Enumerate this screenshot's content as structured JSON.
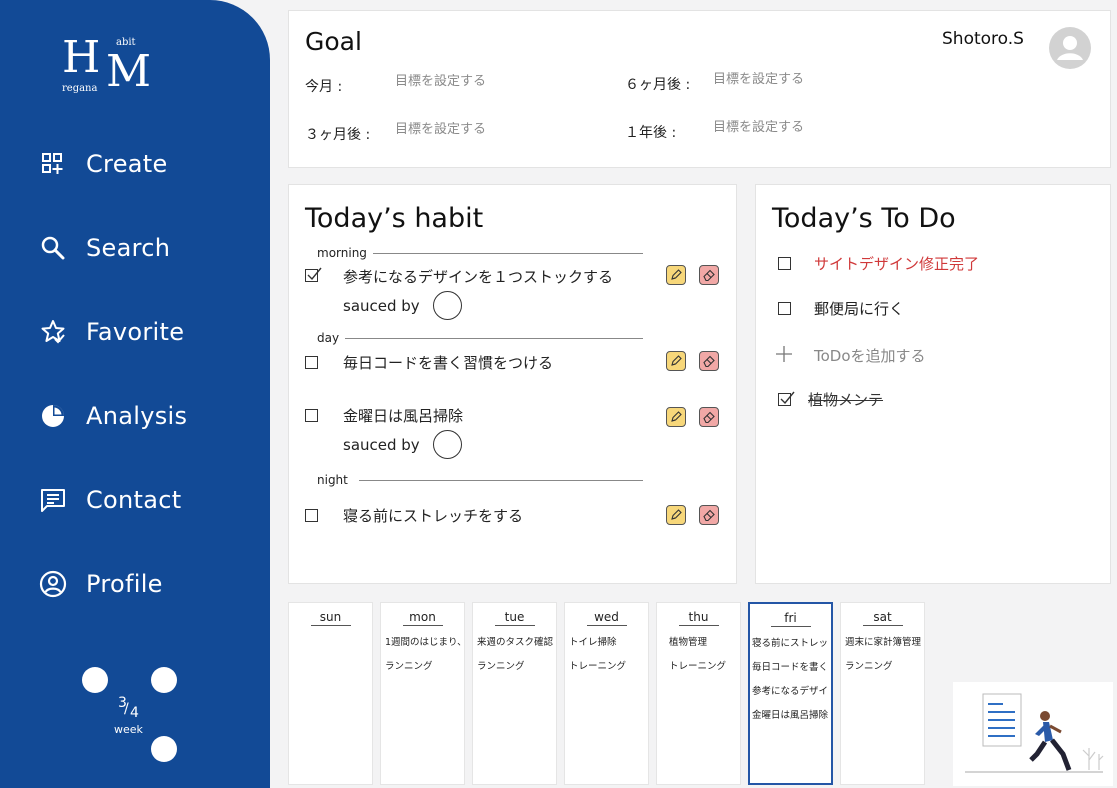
{
  "app": {
    "logo": {
      "big_h": "H",
      "big_m": "M",
      "small_abit": "abit",
      "small_regana": "regana"
    }
  },
  "sidebar": {
    "items": [
      {
        "label": "Create",
        "icon": "create-icon"
      },
      {
        "label": "Search",
        "icon": "search-icon"
      },
      {
        "label": "Favorite",
        "icon": "favorite-icon"
      },
      {
        "label": "Analysis",
        "icon": "analysis-icon"
      },
      {
        "label": "Contact",
        "icon": "contact-icon"
      },
      {
        "label": "Profile",
        "icon": "profile-icon"
      }
    ],
    "week": {
      "numerator": "3",
      "slash": "/",
      "denominator": "4",
      "label": "week"
    }
  },
  "goal": {
    "title": "Goal",
    "user": "Shotoro.S",
    "rows": [
      {
        "key": "今月 :",
        "placeholder": "目標を設定する"
      },
      {
        "key": "６ヶ月後 :",
        "placeholder": "目標を設定する"
      },
      {
        "key": "３ヶ月後 :",
        "placeholder": "目標を設定する"
      },
      {
        "key": "１年後 :",
        "placeholder": "目標を設定する"
      }
    ]
  },
  "habit": {
    "title": "Today’s habit",
    "sections": {
      "morning": "morning",
      "day": "day",
      "night": "night"
    },
    "items": [
      {
        "text": "参考になるデザインを１つストックする",
        "checked": true,
        "sauced": "sauced by"
      },
      {
        "text": "毎日コードを書く習慣をつける",
        "checked": false
      },
      {
        "text": "金曜日は風呂掃除",
        "checked": false,
        "sauced": "sauced by"
      },
      {
        "text": "寝る前にストレッチをする",
        "checked": false
      }
    ]
  },
  "todo": {
    "title": "Today’s To Do",
    "items": [
      {
        "text": "サイトデザイン修正完了",
        "checked": false,
        "color": "#d0393a"
      },
      {
        "text": "郵便局に行く",
        "checked": false
      },
      {
        "text": "ToDoを追加する",
        "type": "add"
      },
      {
        "text": "植物メンテ",
        "checked": true
      }
    ]
  },
  "week": {
    "days": [
      {
        "name": "sun",
        "items": []
      },
      {
        "name": "mon",
        "items": [
          "1週間のはじまり、",
          "ランニング"
        ]
      },
      {
        "name": "tue",
        "items": [
          "来週のタスク確認",
          "ランニング"
        ]
      },
      {
        "name": "wed",
        "items": [
          "トイレ掃除",
          "トレーニング"
        ]
      },
      {
        "name": "thu",
        "items": [
          "植物管理",
          "トレーニング"
        ]
      },
      {
        "name": "fri",
        "items": [
          "寝る前にストレッ",
          "毎日コードを書く",
          "参考になるデザイ",
          "金曜日は風呂掃除"
        ],
        "active": true
      },
      {
        "name": "sat",
        "items": [
          "週末に家計簿管理",
          "ランニング"
        ]
      }
    ]
  },
  "colors": {
    "sidebar": "#124a96",
    "edit_button": "#f7d77a",
    "delete_button": "#f1a8a6",
    "todo_alert": "#d0393a",
    "active_day_border": "#2456a6"
  }
}
